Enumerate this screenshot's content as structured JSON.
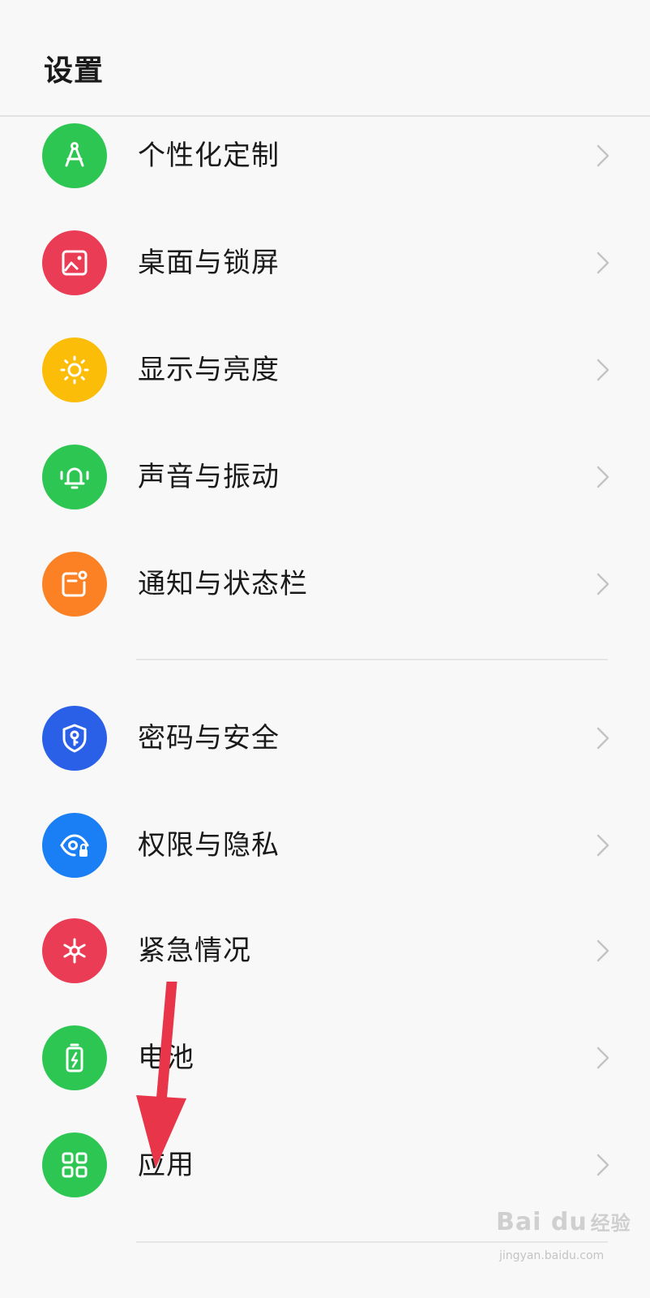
{
  "header": {
    "title": "设置"
  },
  "items": [
    {
      "label": "个性化定制",
      "icon": "compass-icon",
      "color": "#2dc653"
    },
    {
      "label": "桌面与锁屏",
      "icon": "image-icon",
      "color": "#eb3c55"
    },
    {
      "label": "显示与亮度",
      "icon": "sun-icon",
      "color": "#fbbd08"
    },
    {
      "label": "声音与振动",
      "icon": "bell-icon",
      "color": "#2dc653"
    },
    {
      "label": "通知与状态栏",
      "icon": "notification-icon",
      "color": "#fb8124"
    },
    {
      "label": "密码与安全",
      "icon": "shield-key-icon",
      "color": "#2a5fe8"
    },
    {
      "label": "权限与隐私",
      "icon": "eye-lock-icon",
      "color": "#1a7ef5"
    },
    {
      "label": "紧急情况",
      "icon": "emergency-icon",
      "color": "#eb3c55"
    },
    {
      "label": "电池",
      "icon": "battery-icon",
      "color": "#2dc653"
    },
    {
      "label": "应用",
      "icon": "apps-grid-icon",
      "color": "#2dc653"
    }
  ],
  "watermark": {
    "logo": "Bai du",
    "logo_cn": "经验",
    "url": "jingyan.baidu.com"
  }
}
